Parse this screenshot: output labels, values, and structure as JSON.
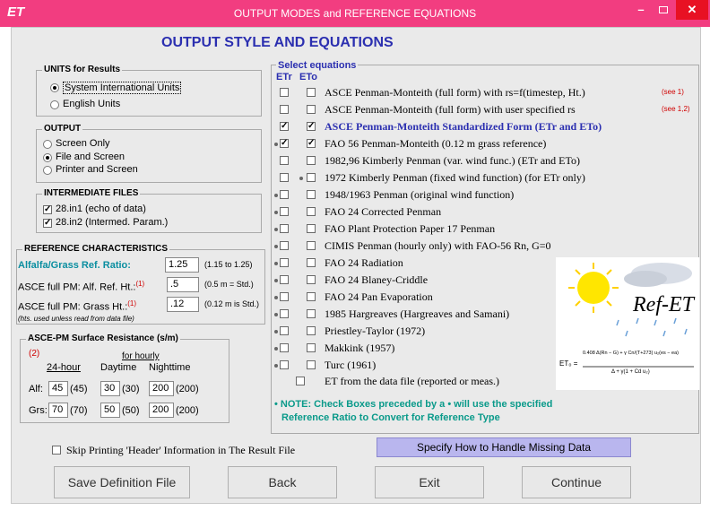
{
  "window": {
    "icon_text": "ET",
    "title": "OUTPUT MODES and REFERENCE EQUATIONS",
    "min": "–",
    "close": "✕"
  },
  "main_title": "OUTPUT STYLE AND EQUATIONS",
  "units": {
    "label": "UNITS for Results",
    "options": [
      "System International Units",
      "English Units"
    ],
    "selected": "System International Units"
  },
  "output": {
    "label": "OUTPUT",
    "options": [
      "Screen Only",
      "File and Screen",
      "Printer and Screen"
    ],
    "selected": "File and Screen"
  },
  "intermediate": {
    "label": "INTERMEDIATE FILES",
    "items": [
      {
        "label": "28.in1 (echo of data)",
        "checked": true
      },
      {
        "label": "28.in2 (Intermed. Param.)",
        "checked": true
      }
    ]
  },
  "reference": {
    "label": "REFERENCE CHARACTERISTICS",
    "ratio_label": "Alfalfa/Grass Ref. Ratio:",
    "ratio_value": "1.25",
    "ratio_hint": "(1.15 to 1.25)",
    "alf_label": "ASCE full PM:  Alf. Ref. Ht.:",
    "alf_sup": "(1)",
    "alf_value": ".5",
    "alf_hint": "(0.5 m = Std.)",
    "grs_label": "ASCE full PM:  Grass Ht.:",
    "grs_sup": "(1)",
    "grs_value": ".12",
    "grs_hint": "(0.12 m is Std.)",
    "note": "(hts. used unless read from data file)"
  },
  "resistance": {
    "label": "ASCE-PM Surface Resistance (s/m)",
    "note": "(2)",
    "col_24": "24-hour",
    "col_hourly": "for hourly",
    "col_day": "Daytime",
    "col_night": "Nighttime",
    "rows": [
      {
        "label": "Alf:",
        "h24": "45",
        "h24_std": "(45)",
        "day": "30",
        "day_std": "(30)",
        "night": "200",
        "night_std": "(200)"
      },
      {
        "label": "Grs:",
        "h24": "70",
        "h24_std": "(70)",
        "day": "50",
        "day_std": "(50)",
        "night": "200",
        "night_std": "(200)"
      }
    ]
  },
  "equations": {
    "label": "Select equations",
    "col_etr": "ETr",
    "col_eto": "ETo",
    "items": [
      {
        "text": "ASCE Penman-Monteith (full form) with rs=f(timestep, Ht.)",
        "etr": false,
        "eto": false,
        "dot_etr": false,
        "dot_eto": false,
        "note": "(see 1)"
      },
      {
        "text": "ASCE Penman-Monteith (full form) with user specified rs",
        "etr": false,
        "eto": false,
        "dot_etr": false,
        "dot_eto": false,
        "note": "(see 1,2)"
      },
      {
        "text": "ASCE Penman-Monteith Standardized Form (ETr and ETo)",
        "etr": true,
        "eto": true,
        "dot_etr": false,
        "dot_eto": false,
        "note": ""
      },
      {
        "text": "FAO 56 Penman-Monteith (0.12 m grass reference)",
        "etr": true,
        "eto": true,
        "dot_etr": true,
        "dot_eto": false,
        "note": ""
      },
      {
        "text": "1982,96 Kimberly Penman (var. wind func.) (ETr and ETo)",
        "etr": false,
        "eto": false,
        "dot_etr": false,
        "dot_eto": false,
        "note": ""
      },
      {
        "text": "1972 Kimberly Penman (fixed wind function) (for ETr only)",
        "etr": false,
        "eto": false,
        "dot_etr": false,
        "dot_eto": true,
        "note": ""
      },
      {
        "text": "1948/1963 Penman (original wind function)",
        "etr": false,
        "eto": false,
        "dot_etr": true,
        "dot_eto": false,
        "note": ""
      },
      {
        "text": "FAO 24 Corrected Penman",
        "etr": false,
        "eto": false,
        "dot_etr": true,
        "dot_eto": false,
        "note": ""
      },
      {
        "text": "FAO Plant Protection Paper 17 Penman",
        "etr": false,
        "eto": false,
        "dot_etr": true,
        "dot_eto": false,
        "note": ""
      },
      {
        "text": "CIMIS Penman (hourly only) with FAO-56 Rn, G=0",
        "etr": false,
        "eto": false,
        "dot_etr": true,
        "dot_eto": false,
        "note": ""
      },
      {
        "text": "FAO 24  Radiation",
        "etr": false,
        "eto": false,
        "dot_etr": true,
        "dot_eto": false,
        "note": ""
      },
      {
        "text": "FAO 24  Blaney-Criddle",
        "etr": false,
        "eto": false,
        "dot_etr": true,
        "dot_eto": false,
        "note": ""
      },
      {
        "text": "FAO 24  Pan Evaporation",
        "etr": false,
        "eto": false,
        "dot_etr": true,
        "dot_eto": false,
        "note": ""
      },
      {
        "text": "1985 Hargreaves (Hargreaves and Samani)",
        "etr": false,
        "eto": false,
        "dot_etr": true,
        "dot_eto": false,
        "note": ""
      },
      {
        "text": "Priestley-Taylor (1972)",
        "etr": false,
        "eto": false,
        "dot_etr": true,
        "dot_eto": false,
        "note": ""
      },
      {
        "text": "Makkink (1957)",
        "etr": false,
        "eto": false,
        "dot_etr": true,
        "dot_eto": false,
        "note": ""
      },
      {
        "text": "Turc (1961)",
        "etr": false,
        "eto": false,
        "dot_etr": true,
        "dot_eto": false,
        "note": ""
      }
    ],
    "file_option": "ET from the data file (reported or meas.)",
    "note_line1": "• NOTE: Check Boxes preceded by a •  will use the specified",
    "note_line2": "Reference Ratio to Convert for Reference Type"
  },
  "logo": {
    "text": "Ref-ET",
    "formula_label": "ET₀ =",
    "formula_num": "0.408 Δ(Rn − G) + γ Cn/(T+273) u₂(es − ea)",
    "formula_den": "Δ + γ(1 + Cd u₂)"
  },
  "colors": {
    "titlebar": "#f23d80",
    "accent_blue": "#2b2fb0",
    "teal": "#0a8ea0",
    "note_teal": "#0a9a8a",
    "red": "#d00000",
    "missing_button": "#b9b6ee"
  },
  "skip_header": {
    "label": "Skip Printing 'Header' Information in The Result File",
    "checked": false
  },
  "missing_button": "Specify How to Handle Missing Data",
  "buttons": {
    "save": "Save Definition File",
    "back": "Back",
    "exit": "Exit",
    "continue": "Continue"
  }
}
